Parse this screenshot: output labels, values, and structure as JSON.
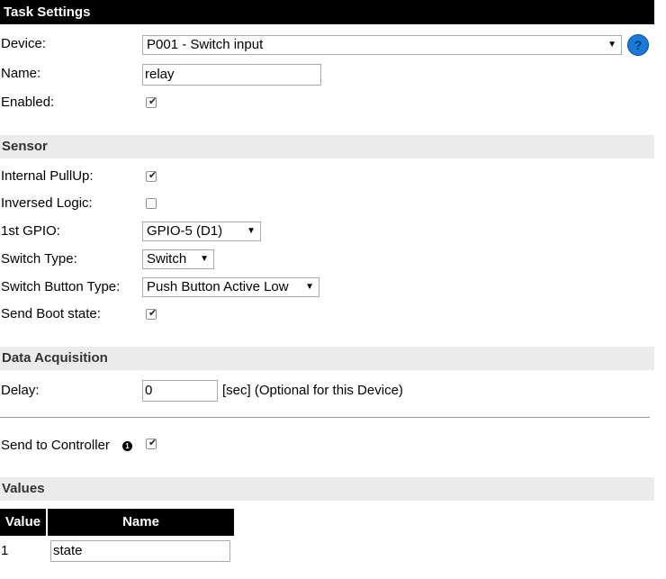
{
  "title": "Task Settings",
  "device": {
    "label": "Device:",
    "selected": "P001 - Switch input",
    "help_glyph": "?"
  },
  "name": {
    "label": "Name:",
    "value": "relay"
  },
  "enabled": {
    "label": "Enabled:",
    "checked": true
  },
  "sensor_section": {
    "heading": "Sensor",
    "internal_pullup": {
      "label": "Internal PullUp:",
      "checked": true
    },
    "inversed_logic": {
      "label": "Inversed Logic:",
      "checked": false
    },
    "gpio": {
      "label": "1st GPIO:",
      "selected": "GPIO-5 (D1)"
    },
    "switch_type": {
      "label": "Switch Type:",
      "selected": "Switch"
    },
    "switch_button_type": {
      "label": "Switch Button Type:",
      "selected": "Push Button Active Low"
    },
    "send_boot_state": {
      "label": "Send Boot state:",
      "checked": true
    }
  },
  "data_acquisition": {
    "heading": "Data Acquisition",
    "delay": {
      "label": "Delay:",
      "value": "0",
      "unit_note": "[sec] (Optional for this Device)"
    },
    "send_to_controller": {
      "label": "Send to Controller",
      "info_glyph": "1",
      "checked": true
    }
  },
  "values_section": {
    "heading": "Values",
    "columns": [
      "Value",
      "Name"
    ],
    "rows": [
      {
        "index": "1",
        "name": "state"
      }
    ]
  },
  "icons": {
    "dropdown": "triangle-down-icon",
    "help": "question-mark-circle-icon",
    "info": "info-circle-icon",
    "check": "checkmark-icon"
  },
  "colors": {
    "header_bg": "#000000",
    "section_bg": "#ebebeb",
    "help_blue": "#1a7ad6"
  }
}
